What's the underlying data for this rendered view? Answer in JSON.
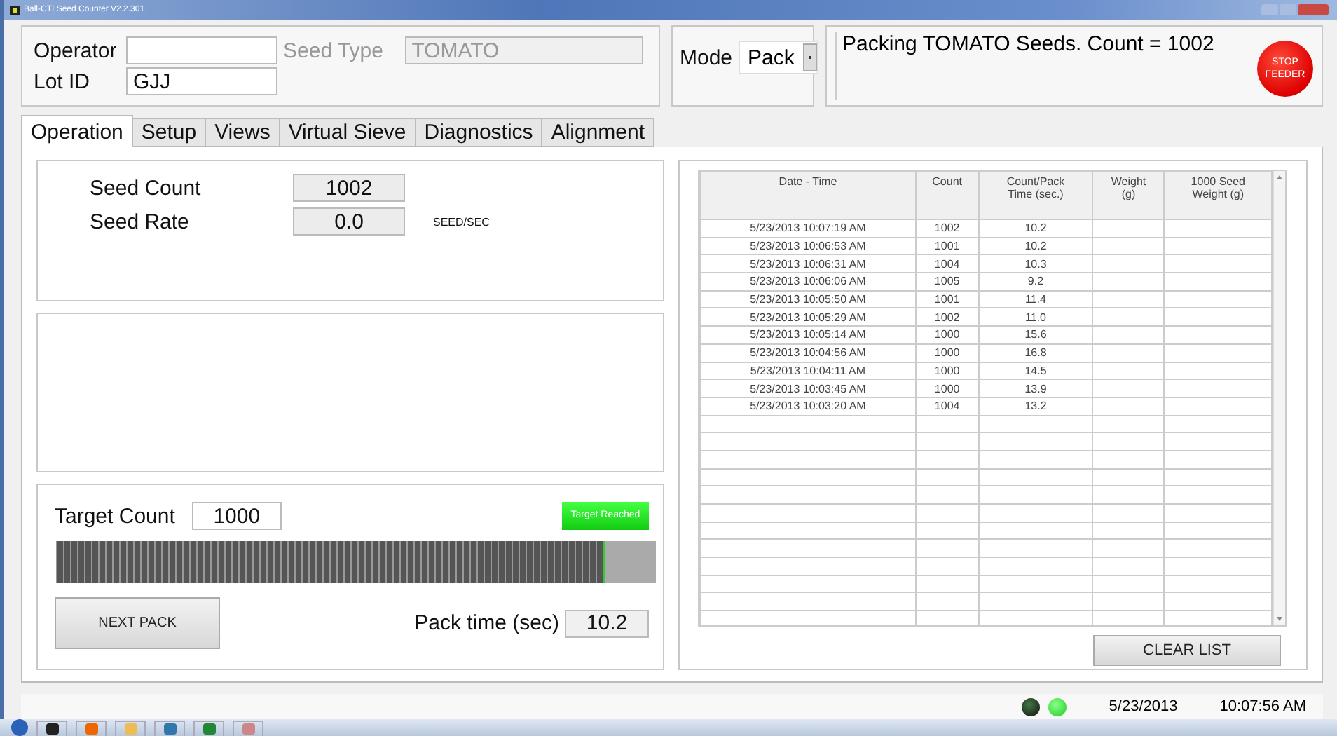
{
  "window": {
    "title": "Ball-CTI Seed Counter V2.2.301"
  },
  "header": {
    "operator": {
      "label": "Operator"
    },
    "lot_id": {
      "label": "Lot ID",
      "value": "GJJ"
    },
    "seed_type": {
      "label": "Seed Type",
      "value": "TOMATO",
      "disabled": true
    },
    "mode": {
      "label": "Mode",
      "value": "Pack"
    },
    "message": "Packing TOMATO Seeds.  Count = 1002",
    "stop_button": [
      "STOP",
      "FEEDER"
    ]
  },
  "tabs": [
    {
      "label": "Operation",
      "selected": true
    },
    {
      "label": "Setup",
      "selected": false
    },
    {
      "label": "Views",
      "selected": false
    },
    {
      "label": "Virtual Sieve",
      "selected": false
    },
    {
      "label": "Diagnostics",
      "selected": false
    },
    {
      "label": "Alignment",
      "selected": false
    }
  ],
  "stats": [
    {
      "label": "Seed Count",
      "value": "1002"
    },
    {
      "label": "Seed Rate",
      "value": "0.0",
      "unit": "SEED/SEC"
    }
  ],
  "target": {
    "label": "Target Count",
    "value": "1000",
    "indicator": {
      "label": "Target Reached",
      "on": true
    },
    "progress": {
      "level": 0.915
    },
    "next_button": "NEXT PACK",
    "pack_time": {
      "label": "Pack time (sec)",
      "value": "10.2"
    }
  },
  "table": {
    "columns": [
      "Date - Time",
      "Count",
      "Count/Pack\nTime (sec.)",
      "Weight\n(g)",
      "1000 Seed\nWeight (g)"
    ],
    "rows": [
      [
        "5/23/2013 10:07:19 AM",
        "1002",
        "10.2",
        "",
        ""
      ],
      [
        "5/23/2013 10:06:53 AM",
        "1001",
        "10.2",
        "",
        ""
      ],
      [
        "5/23/2013 10:06:31 AM",
        "1004",
        "10.3",
        "",
        ""
      ],
      [
        "5/23/2013 10:06:06 AM",
        "1005",
        "9.2",
        "",
        ""
      ],
      [
        "5/23/2013 10:05:50 AM",
        "1001",
        "11.4",
        "",
        ""
      ],
      [
        "5/23/2013 10:05:29 AM",
        "1002",
        "11.0",
        "",
        ""
      ],
      [
        "5/23/2013 10:05:14 AM",
        "1000",
        "15.6",
        "",
        ""
      ],
      [
        "5/23/2013 10:04:56 AM",
        "1000",
        "16.8",
        "",
        ""
      ],
      [
        "5/23/2013 10:04:11 AM",
        "1000",
        "14.5",
        "",
        ""
      ],
      [
        "5/23/2013 10:03:45 AM",
        "1000",
        "13.9",
        "",
        ""
      ],
      [
        "5/23/2013 10:03:20 AM",
        "1004",
        "13.2",
        "",
        ""
      ]
    ]
  },
  "clear_button": "CLEAR LIST",
  "status_bar": {
    "leds": [
      {
        "on": false
      },
      {
        "on": true
      }
    ],
    "date": "5/23/2013",
    "time": "10:07:56 AM"
  }
}
